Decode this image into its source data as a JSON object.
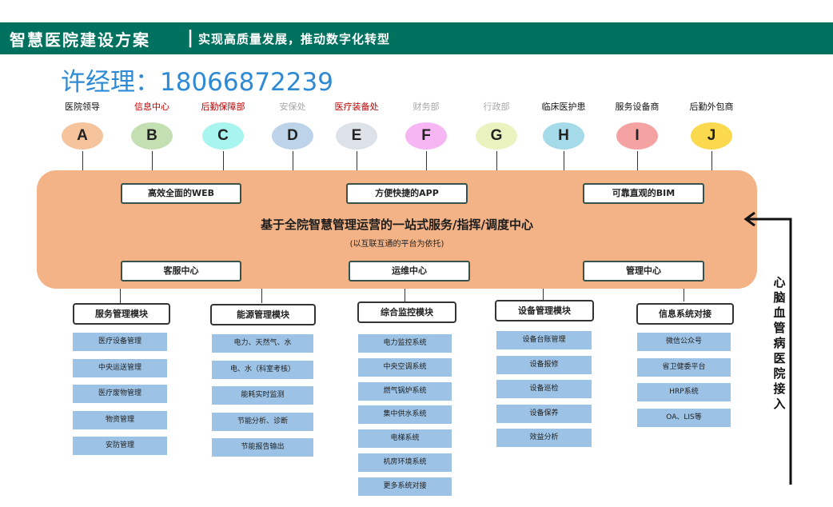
{
  "banner": {
    "title": "智慧医院建设方案",
    "separator": "|",
    "subtitle": "实现高质量发展，推动数字化转型",
    "bg_color": "#00715f"
  },
  "contact": "许经理：18066872239",
  "departments": [
    {
      "label": "医院领导",
      "letter": "A",
      "color": "#f5c39c",
      "label_color": "#111111"
    },
    {
      "label": "信息中心",
      "letter": "B",
      "color": "#c4dfb2",
      "label_color": "#c00000"
    },
    {
      "label": "后勤保障部",
      "letter": "C",
      "color": "#a8f4ef",
      "label_color": "#c00000"
    },
    {
      "label": "安保处",
      "letter": "D",
      "color": "#bdd3ea",
      "label_color": "#a6a6a6"
    },
    {
      "label": "医疗装备处",
      "letter": "E",
      "color": "#dde1e8",
      "label_color": "#c00000"
    },
    {
      "label": "财务部",
      "letter": "F",
      "color": "#f6b5f3",
      "label_color": "#a6a6a6"
    },
    {
      "label": "行政部",
      "letter": "G",
      "color": "#eaf3c0",
      "label_color": "#a6a6a6"
    },
    {
      "label": "临床医护患",
      "letter": "H",
      "color": "#a5dbe9",
      "label_color": "#111111"
    },
    {
      "label": "服务设备商",
      "letter": "I",
      "color": "#f4a2a2",
      "label_color": "#111111"
    },
    {
      "label": "后勤外包商",
      "letter": "J",
      "color": "#fbd94e",
      "label_color": "#111111"
    }
  ],
  "hub": {
    "top_boxes": [
      "高效全面的WEB",
      "方便快捷的APP",
      "可靠直观的BIM"
    ],
    "title": "基于全院智慧管理运营的一站式服务/指挥/调度中心",
    "subtitle": "(以互联互通的平台为依托)",
    "bottom_boxes": [
      "客服中心",
      "运维中心",
      "管理中心"
    ],
    "color": "#f3b386"
  },
  "modules": [
    {
      "title": "服务管理模块",
      "items": [
        "医疗设备管理",
        "中央运送管理",
        "医疗废物管理",
        "物资管理",
        "安防管理"
      ]
    },
    {
      "title": "能源管理模块",
      "items": [
        "电力、天然气、水",
        "电、水（科室考核）",
        "能耗实时监测",
        "节能分析、诊断",
        "节能报告输出"
      ]
    },
    {
      "title": "综合监控模块",
      "items": [
        "电力监控系统",
        "中央空调系统",
        "燃气锅炉系统",
        "集中供水系统",
        "电梯系统",
        "机房环境系统",
        "更多系统对接"
      ]
    },
    {
      "title": "设备管理模块",
      "items": [
        "设备台账管理",
        "设备报修",
        "设备巡检",
        "设备保养",
        "效益分析"
      ]
    },
    {
      "title": "信息系统对接",
      "items": [
        "微信公众号",
        "省卫健委平台",
        "HRP系统",
        "OA、LIS等"
      ]
    }
  ],
  "side_label": "心脑血管病医院接入",
  "item_color": "#9cc2e5"
}
